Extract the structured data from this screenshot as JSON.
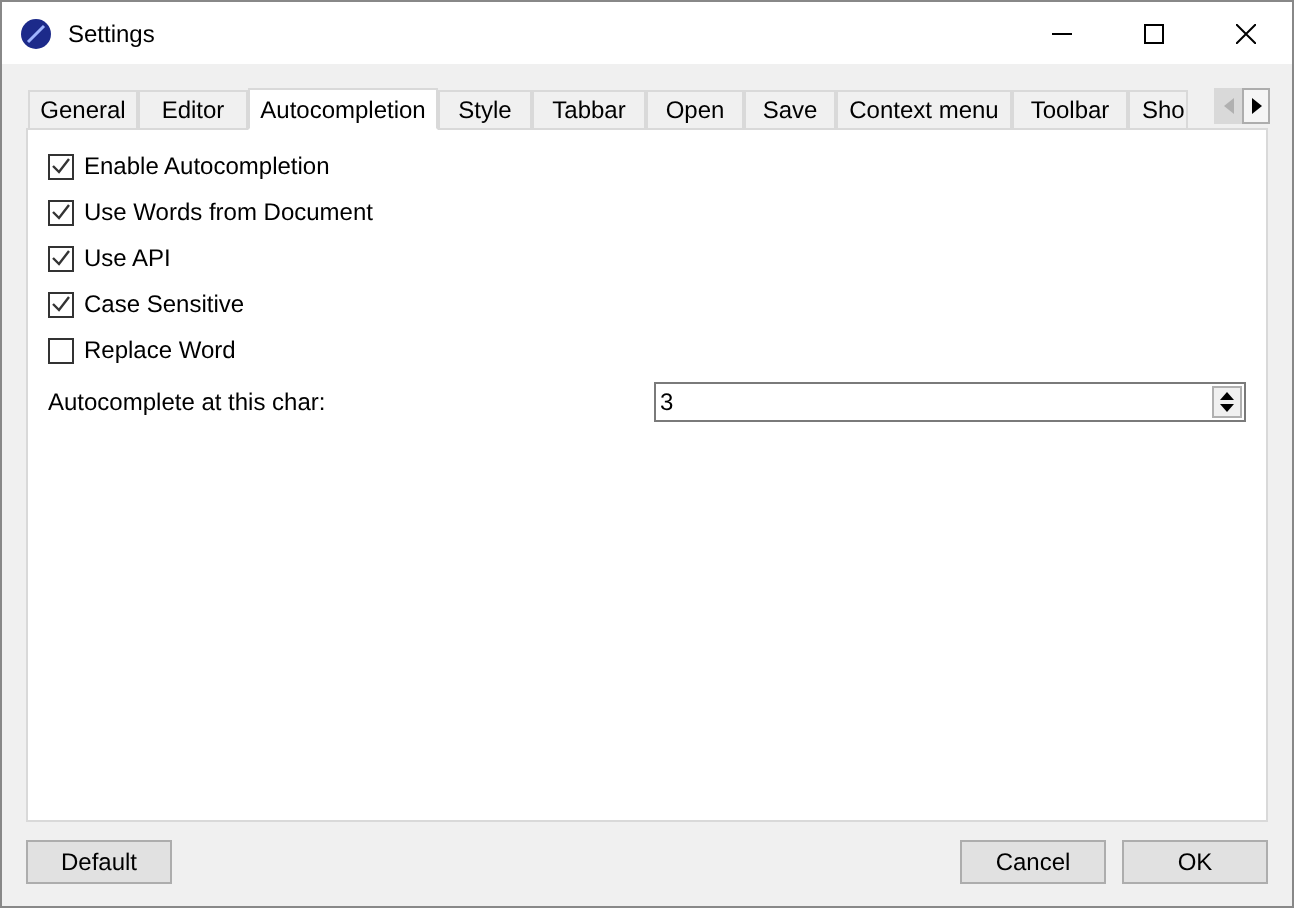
{
  "window": {
    "title": "Settings"
  },
  "tabs": [
    {
      "label": "General",
      "selected": false
    },
    {
      "label": "Editor",
      "selected": false
    },
    {
      "label": "Autocompletion",
      "selected": true
    },
    {
      "label": "Style",
      "selected": false
    },
    {
      "label": "Tabbar",
      "selected": false
    },
    {
      "label": "Open",
      "selected": false
    },
    {
      "label": "Save",
      "selected": false
    },
    {
      "label": "Context menu",
      "selected": false
    },
    {
      "label": "Toolbar",
      "selected": false
    },
    {
      "label": "Sho",
      "selected": false
    }
  ],
  "options": [
    {
      "label": "Enable Autocompletion",
      "checked": true
    },
    {
      "label": "Use Words from Document",
      "checked": true
    },
    {
      "label": "Use API",
      "checked": true
    },
    {
      "label": "Case Sensitive",
      "checked": true
    },
    {
      "label": "Replace Word",
      "checked": false
    }
  ],
  "char_field": {
    "label": "Autocomplete at this char:",
    "value": "3"
  },
  "buttons": {
    "left": [
      "Default"
    ],
    "right": [
      "Cancel",
      "OK"
    ]
  }
}
